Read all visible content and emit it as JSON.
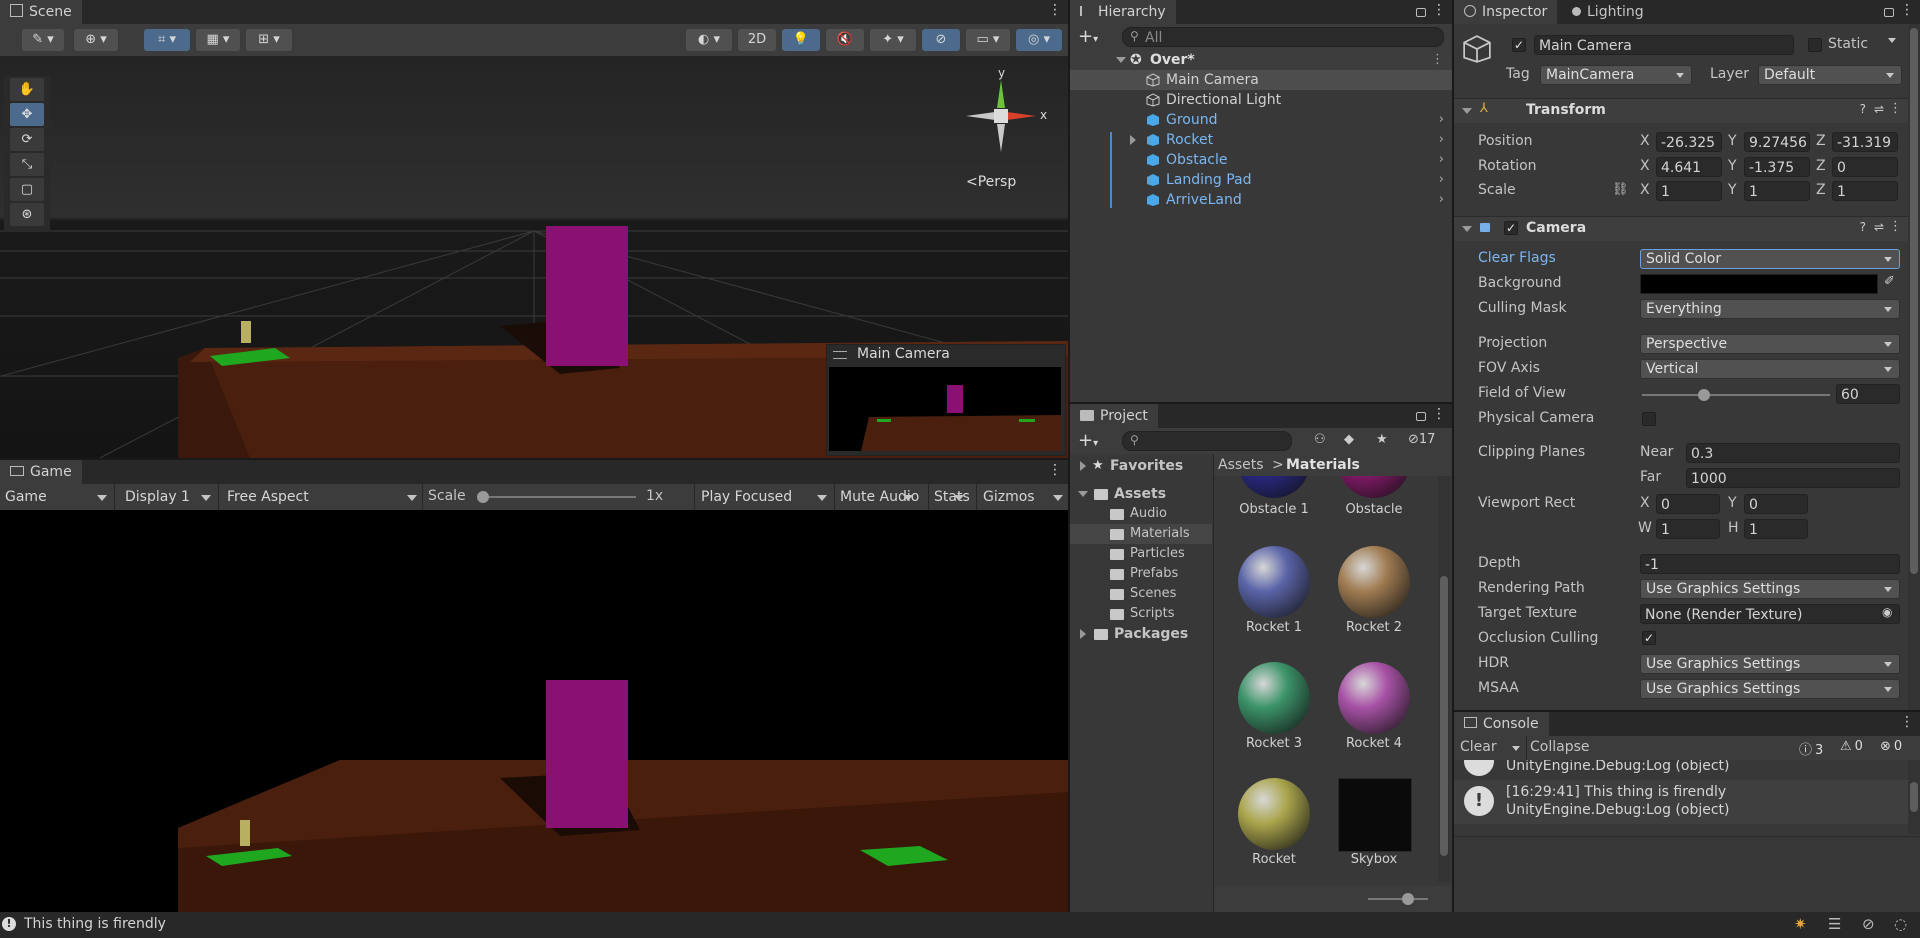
{
  "scene": {
    "tab": "Scene",
    "btn_2d": "2D",
    "persp_label": "Persp",
    "axis_y": "y",
    "axis_x": "x",
    "overlay_title": "Main Camera"
  },
  "game": {
    "tab": "Game",
    "view_dropdown": "Game",
    "display": "Display 1",
    "aspect": "Free Aspect",
    "scale_label": "Scale",
    "scale_value": "1x",
    "play_mode": "Play Focused",
    "mute": "Mute Audio",
    "stats": "Stats",
    "gizmos": "Gizmos"
  },
  "hierarchy": {
    "tab": "Hierarchy",
    "search_placeholder": "All",
    "scene_name": "Over*",
    "items": [
      {
        "label": "Main Camera",
        "prefab": false,
        "selected": true
      },
      {
        "label": "Directional Light",
        "prefab": false
      },
      {
        "label": "Ground",
        "prefab": true
      },
      {
        "label": "Rocket",
        "prefab": true,
        "expandable": true
      },
      {
        "label": "Obstacle",
        "prefab": true
      },
      {
        "label": "Landing Pad",
        "prefab": true
      },
      {
        "label": "ArriveLand",
        "prefab": true
      }
    ]
  },
  "project": {
    "tab": "Project",
    "hidden_count": "17",
    "tree": {
      "favorites": "Favorites",
      "assets": "Assets",
      "folders": [
        "Audio",
        "Materials",
        "Particles",
        "Prefabs",
        "Scenes",
        "Scripts"
      ],
      "packages": "Packages"
    },
    "breadcrumb": {
      "root": "Assets",
      "sep": ">",
      "current": "Materials"
    },
    "materials": [
      {
        "label": "Obstacle 1",
        "color": "#2a2a8a"
      },
      {
        "label": "Obstacle",
        "color": "#8a1a6e"
      },
      {
        "label": "Rocket 1",
        "color": "#5a64a8"
      },
      {
        "label": "Rocket 2",
        "color": "#a07c52"
      },
      {
        "label": "Rocket 3",
        "color": "#3c946a"
      },
      {
        "label": "Rocket 4",
        "color": "#a852a6"
      },
      {
        "label": "Rocket",
        "color": "#aaa54c"
      },
      {
        "label": "Skybox",
        "color": "#0a0a0a"
      }
    ]
  },
  "inspector": {
    "tab": "Inspector",
    "tab2": "Lighting",
    "object_name": "Main Camera",
    "static_label": "Static",
    "tag_label": "Tag",
    "tag_value": "MainCamera",
    "layer_label": "Layer",
    "layer_value": "Default",
    "transform": {
      "title": "Transform",
      "position_label": "Position",
      "rotation_label": "Rotation",
      "scale_label": "Scale",
      "position": [
        "-26.325",
        "9.27456",
        "-31.319"
      ],
      "rotation": [
        "4.641",
        "-1.375",
        "0"
      ],
      "scale": [
        "1",
        "1",
        "1"
      ]
    },
    "camera": {
      "title": "Camera",
      "clear_flags_label": "Clear Flags",
      "clear_flags_value": "Solid Color",
      "background_label": "Background",
      "background_color": "#000000",
      "culling_label": "Culling Mask",
      "culling_value": "Everything",
      "projection_label": "Projection",
      "projection_value": "Perspective",
      "fov_axis_label": "FOV Axis",
      "fov_axis_value": "Vertical",
      "fov_label": "Field of View",
      "fov_value": "60",
      "fov_fraction": 0.33,
      "physical_label": "Physical Camera",
      "clipping_label": "Clipping Planes",
      "near_label": "Near",
      "near_value": "0.3",
      "far_label": "Far",
      "far_value": "1000",
      "viewport_label": "Viewport Rect",
      "vp": {
        "x_label": "X",
        "x": "0",
        "y_label": "Y",
        "y": "0",
        "w_label": "W",
        "w": "1",
        "h_label": "H",
        "h": "1"
      },
      "depth_label": "Depth",
      "depth_value": "-1",
      "render_path_label": "Rendering Path",
      "render_path_value": "Use Graphics Settings",
      "target_label": "Target Texture",
      "target_value": "None (Render Texture)",
      "occlusion_label": "Occlusion Culling",
      "hdr_label": "HDR",
      "hdr_value": "Use Graphics Settings",
      "msaa_label": "MSAA",
      "msaa_value": "Use Graphics Settings"
    },
    "axis": {
      "x": "X",
      "y": "Y",
      "z": "Z"
    }
  },
  "console": {
    "tab": "Console",
    "clear": "Clear",
    "collapse": "Collapse",
    "log_count": "3",
    "warn_count": "0",
    "err_count": "0",
    "partial_line": "UnityEngine.Debug:Log (object)",
    "entry_line1": "[16:29:41] This thing is firendly",
    "entry_line2": "UnityEngine.Debug:Log (object)"
  },
  "status": {
    "message": "This thing is firendly"
  }
}
